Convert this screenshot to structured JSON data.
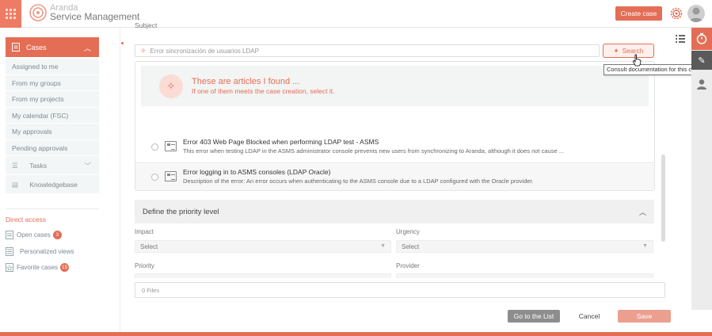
{
  "header": {
    "brand_line1": "Aranda",
    "brand_line2": "Service Management",
    "create_case_label": "Create case"
  },
  "sidebar": {
    "cases_label": "Cases",
    "sub_items": [
      "Assigned to me",
      "From my groups",
      "From my projects",
      "My calendar (FSC)",
      "My approvals",
      "Pending approvals"
    ],
    "tasks_label": "Tasks",
    "knowledgebase_label": "Knowledgebase",
    "direct_access_label": "Direct access",
    "open_cases_label": "Open cases",
    "open_cases_count": "3",
    "personalized_views_label": "Personalized views",
    "favorite_cases_label": "Favorite cases",
    "favorite_cases_count": "15"
  },
  "form": {
    "subject_label": "Subject",
    "subject_placeholder": "Error sincronización de usuarios LDAP",
    "search_label": "Search",
    "tooltip": "Consult documentation for this case"
  },
  "articles": {
    "banner_title": "These are articles I found ...",
    "banner_subtitle": "If one of them meets the case creation, select it.",
    "items": [
      {
        "title": "Error 403 Web Page Blocked when performing LDAP test - ASMS",
        "description": "This error when testing LDAP in the ASMS administrator console prevents new users from synchronizing to Aranda, although it does not cause ..."
      },
      {
        "title": "Error logging in to ASMS consoles (LDAP Oracle)",
        "description": "Description of the error: An error occurs when authenticating to the ASMS console due to a LDAP configured with the Oracle provider."
      }
    ]
  },
  "priority": {
    "section_title": "Define the priority level",
    "impact_label": "Impact",
    "impact_value": "Select",
    "urgency_label": "Urgency",
    "urgency_value": "Select",
    "priority_label": "Priority",
    "provider_label": "Provider"
  },
  "files_label": "0 Files",
  "footer": {
    "go_to_list": "Go to the List",
    "cancel": "Cancel",
    "save": "Save"
  },
  "colors": {
    "accent": "#e46e55",
    "accent_light": "#fbdcd4",
    "save_disabled": "#eb9f8f"
  }
}
